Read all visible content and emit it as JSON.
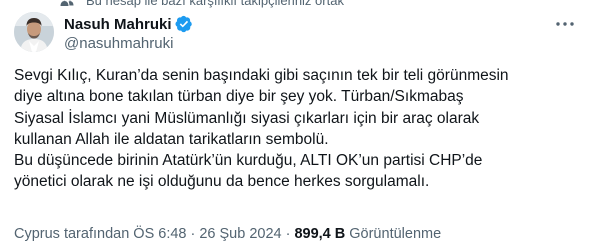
{
  "context": {
    "text": "Bu hesap ile bazı karşılıklı takipçileriniz ortak"
  },
  "author": {
    "display_name": "Nasuh Mahruki",
    "handle": "@nasuhmahruki",
    "verified": true,
    "verified_color": "#1d9bf0"
  },
  "tweet": {
    "lines": [
      "Sevgi Kılıç, Kuran’da senin başındaki gibi saçının tek bir teli görünmesin",
      "diye altına bone takılan türban diye bir şey yok. Türban/Sıkmabaş",
      "Siyasal İslamcı yani Müslümanlığı siyasi çıkarları için bir araç olarak",
      "kullanan Allah ile aldatan tarikatların sembolü.",
      "Bu düşüncede birinin Atatürk’ün kurduğu, ALTI OK’un partisi CHP’de",
      "yönetici olarak ne işi olduğunu da bence herkes sorgulamalı."
    ]
  },
  "meta": {
    "source": "Cyprus tarafından",
    "time": "ÖS 6:48",
    "date": "26 Şub 2024",
    "separator": "·",
    "views_count": "899,4 B",
    "views_label": "Görüntülenme"
  },
  "colors": {
    "text_primary": "#0f1419",
    "text_secondary": "#536471",
    "accent": "#1d9bf0"
  }
}
